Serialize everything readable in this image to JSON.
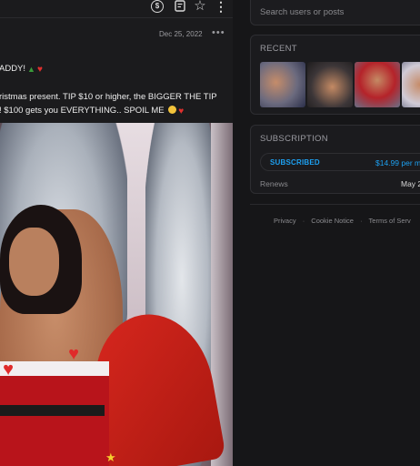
{
  "header": {
    "icons": [
      "coin-icon",
      "note-icon",
      "star-icon",
      "more-icon"
    ],
    "coin_glyph": "$"
  },
  "post": {
    "date": "Dec 25, 2022",
    "more": "•••",
    "line1": "ADDY!",
    "line2": "ristmas present. TIP $10 or higher, the BIGGER THE TIP",
    "line3": "! $100 gets you EVERYTHING.. SPOIL ME"
  },
  "sidebar": {
    "search_placeholder": "Search users or posts",
    "recent_title": "RECENT",
    "subscription_title": "SUBSCRIPTION",
    "subscribed_label": "SUBSCRIBED",
    "price": "$14.99 per mo",
    "renews_label": "Renews",
    "renew_date": "May 2"
  },
  "footer": {
    "privacy": "Privacy",
    "cookie": "Cookie Notice",
    "terms": "Terms of Serv",
    "sep": "·"
  },
  "colors": {
    "accent": "#1da1f2",
    "background": "#161618"
  }
}
